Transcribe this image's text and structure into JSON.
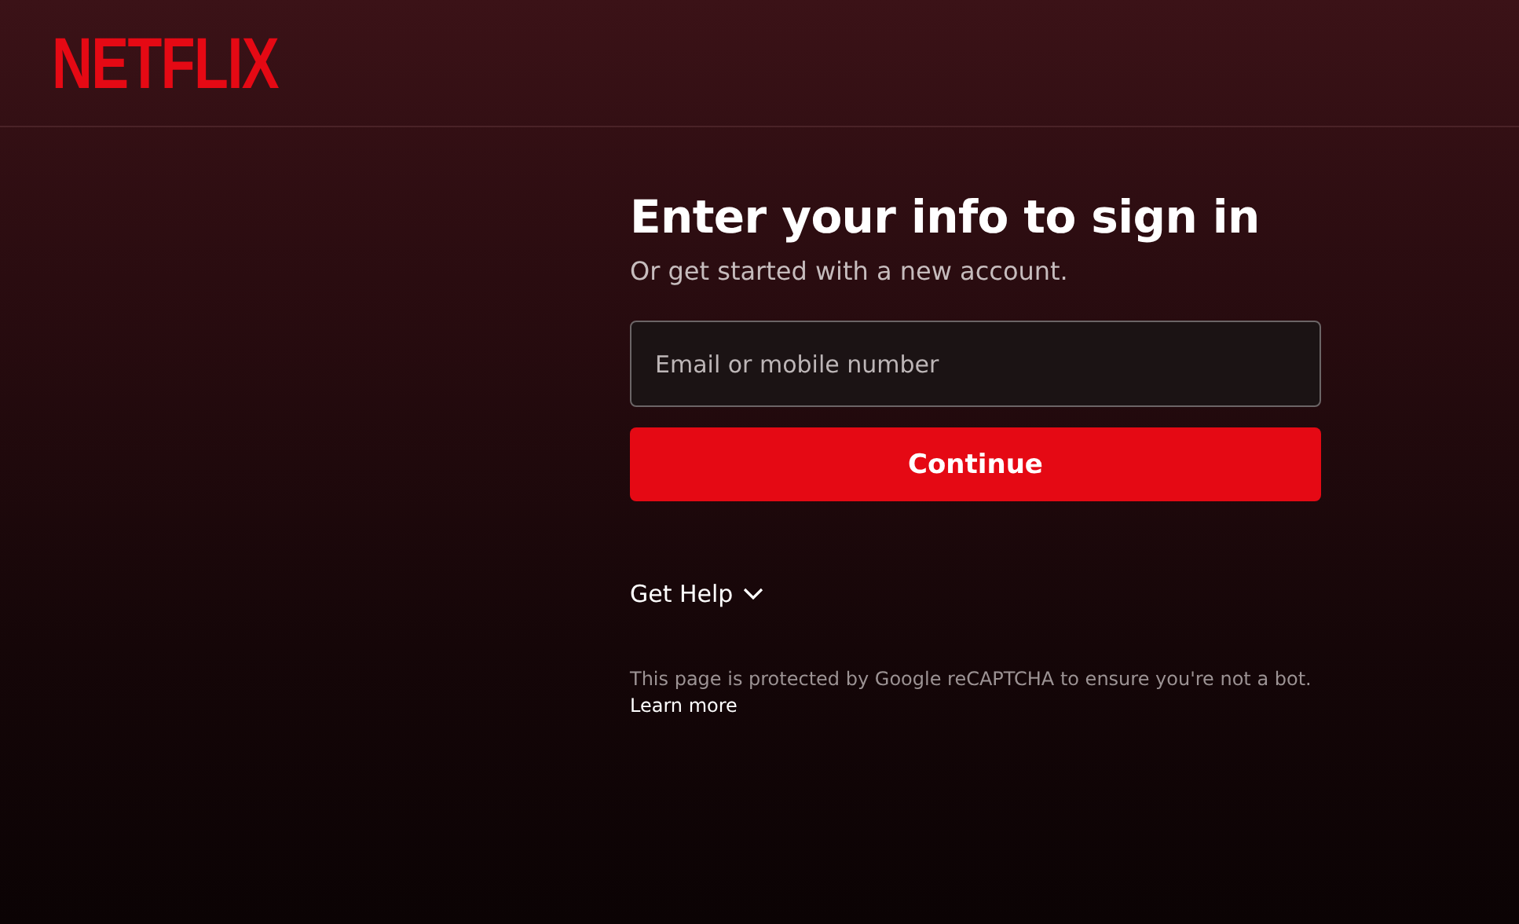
{
  "header": {
    "logo": "NETFLIX"
  },
  "form": {
    "title": "Enter your info to sign in",
    "subtitle": "Or get started with a new account.",
    "email": {
      "placeholder": "Email or mobile number"
    },
    "submit": "Continue",
    "help": {
      "label": "Get Help",
      "expanded": false
    },
    "recaptcha": "This page is protected by Google reCAPTCHA to ensure you're not a bot.",
    "learn_more": "Learn more"
  }
}
